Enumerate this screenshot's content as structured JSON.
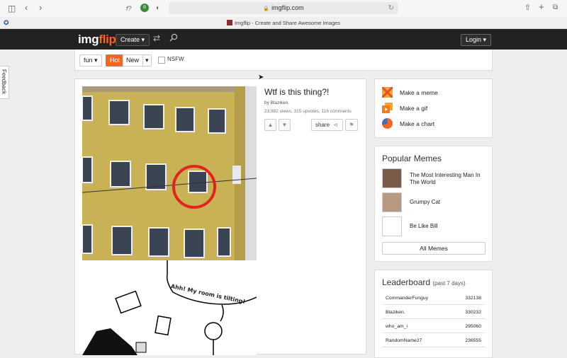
{
  "browser": {
    "url": "imgflip.com",
    "tab_title": "Imgflip - Create and Share Awesome Images"
  },
  "header": {
    "logo_part1": "img",
    "logo_part2": "flip",
    "create_label": "Create ▾",
    "login_label": "Login ▾"
  },
  "filters": {
    "category": "fun ▾",
    "hot_label": "Hot",
    "new_label": "New",
    "new_dropdown": "▾",
    "nsfw_label": "NSFW"
  },
  "feedback_label": "Feedback",
  "post": {
    "title": "Wtf is this thing?!",
    "by_prefix": "by ",
    "author": "Blaziken.",
    "stats": "23,982 views, 315 upvotes, 116 comments",
    "share_label": "share",
    "comic_text": "Ahh! My room is tilting!"
  },
  "make": {
    "items": [
      {
        "label": "Make a meme",
        "icon": "meme-icon",
        "color": "#f5a623"
      },
      {
        "label": "Make a gif",
        "icon": "gif-icon",
        "color": "#f07e1b"
      },
      {
        "label": "Make a chart",
        "icon": "chart-icon",
        "color": "#f26522"
      }
    ]
  },
  "popular": {
    "heading": "Popular Memes",
    "items": [
      {
        "name": "The Most Interesting Man In The World"
      },
      {
        "name": "Grumpy Cat"
      },
      {
        "name": "Be Like Bill"
      }
    ],
    "all_label": "All Memes"
  },
  "leaderboard": {
    "heading": "Leaderboard",
    "subheading": "(past 7 days)",
    "rows": [
      {
        "name": "CommanderFunguy",
        "points": "332138"
      },
      {
        "name": "Blaziken.",
        "points": "330232"
      },
      {
        "name": "who_am_i",
        "points": "295060"
      },
      {
        "name": "RandomName27",
        "points": "236555"
      }
    ]
  }
}
